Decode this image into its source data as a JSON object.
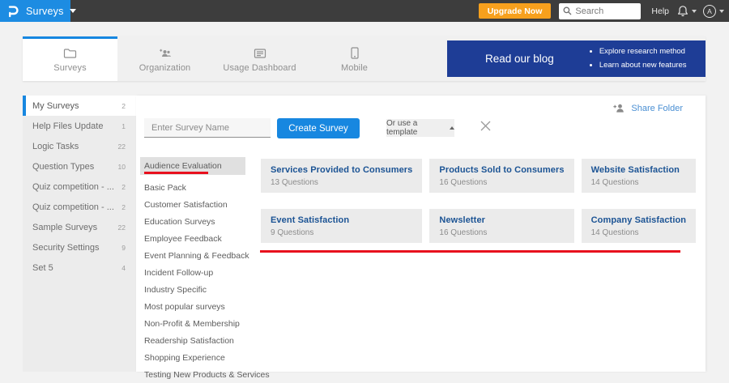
{
  "topbar": {
    "app_menu": "Surveys",
    "upgrade_label": "Upgrade Now",
    "search_placeholder": "Search",
    "help_label": "Help",
    "avatar_initial": "A"
  },
  "header": {
    "tabs": [
      {
        "label": "Surveys",
        "active": true
      },
      {
        "label": "Organization",
        "active": false
      },
      {
        "label": "Usage Dashboard",
        "active": false
      },
      {
        "label": "Mobile",
        "active": false
      }
    ],
    "banner": {
      "title": "Read our blog",
      "bullets": [
        "Explore research method",
        "Learn about new features"
      ]
    }
  },
  "sidebar": {
    "items": [
      {
        "label": "My Surveys",
        "count": "2"
      },
      {
        "label": "Help Files Update",
        "count": "1"
      },
      {
        "label": "Logic Tasks",
        "count": "22"
      },
      {
        "label": "Question Types",
        "count": "10"
      },
      {
        "label": "Quiz competition - ...",
        "count": "2"
      },
      {
        "label": "Quiz competition - ...",
        "count": "2"
      },
      {
        "label": "Sample Surveys",
        "count": "22"
      },
      {
        "label": "Security Settings",
        "count": "9"
      },
      {
        "label": "Set 5",
        "count": "4"
      }
    ]
  },
  "main": {
    "share_folder_label": "Share Folder",
    "survey_name_placeholder": "Enter Survey Name",
    "create_button_label": "Create Survey",
    "template_dropdown_label": "Or use a template",
    "active_category": "Audience Evaluation",
    "categories": [
      {
        "label": "Audience Evaluation"
      },
      {
        "label": "Basic Pack"
      },
      {
        "label": "Customer Satisfaction"
      },
      {
        "label": "Education Surveys"
      },
      {
        "label": "Employee Feedback"
      },
      {
        "label": "Event Planning & Feedback"
      },
      {
        "label": "Incident Follow-up"
      },
      {
        "label": "Industry Specific"
      },
      {
        "label": "Most popular surveys"
      },
      {
        "label": "Non-Profit & Membership"
      },
      {
        "label": "Readership Satisfaction"
      },
      {
        "label": "Shopping Experience"
      },
      {
        "label": "Testing New Products & Services"
      }
    ],
    "templates": [
      {
        "title": "Services Provided to Consumers",
        "questions": "13 Questions"
      },
      {
        "title": "Products Sold to Consumers",
        "questions": "16 Questions"
      },
      {
        "title": "Website Satisfaction",
        "questions": "14 Questions"
      },
      {
        "title": "Event Satisfaction",
        "questions": "9 Questions"
      },
      {
        "title": "Newsletter",
        "questions": "16 Questions"
      },
      {
        "title": "Company Satisfaction",
        "questions": "14 Questions"
      }
    ]
  },
  "colors": {
    "topbar_bg": "#3d3d3d",
    "brand_blue": "#1d8ce2",
    "accent_blue": "#1787e0",
    "upgrade_orange": "#f7a01d",
    "banner_navy": "#1e3d96",
    "card_title_blue": "#1b5394",
    "link_blue": "#4a8fd3",
    "annotation_red": "#e8101d"
  }
}
